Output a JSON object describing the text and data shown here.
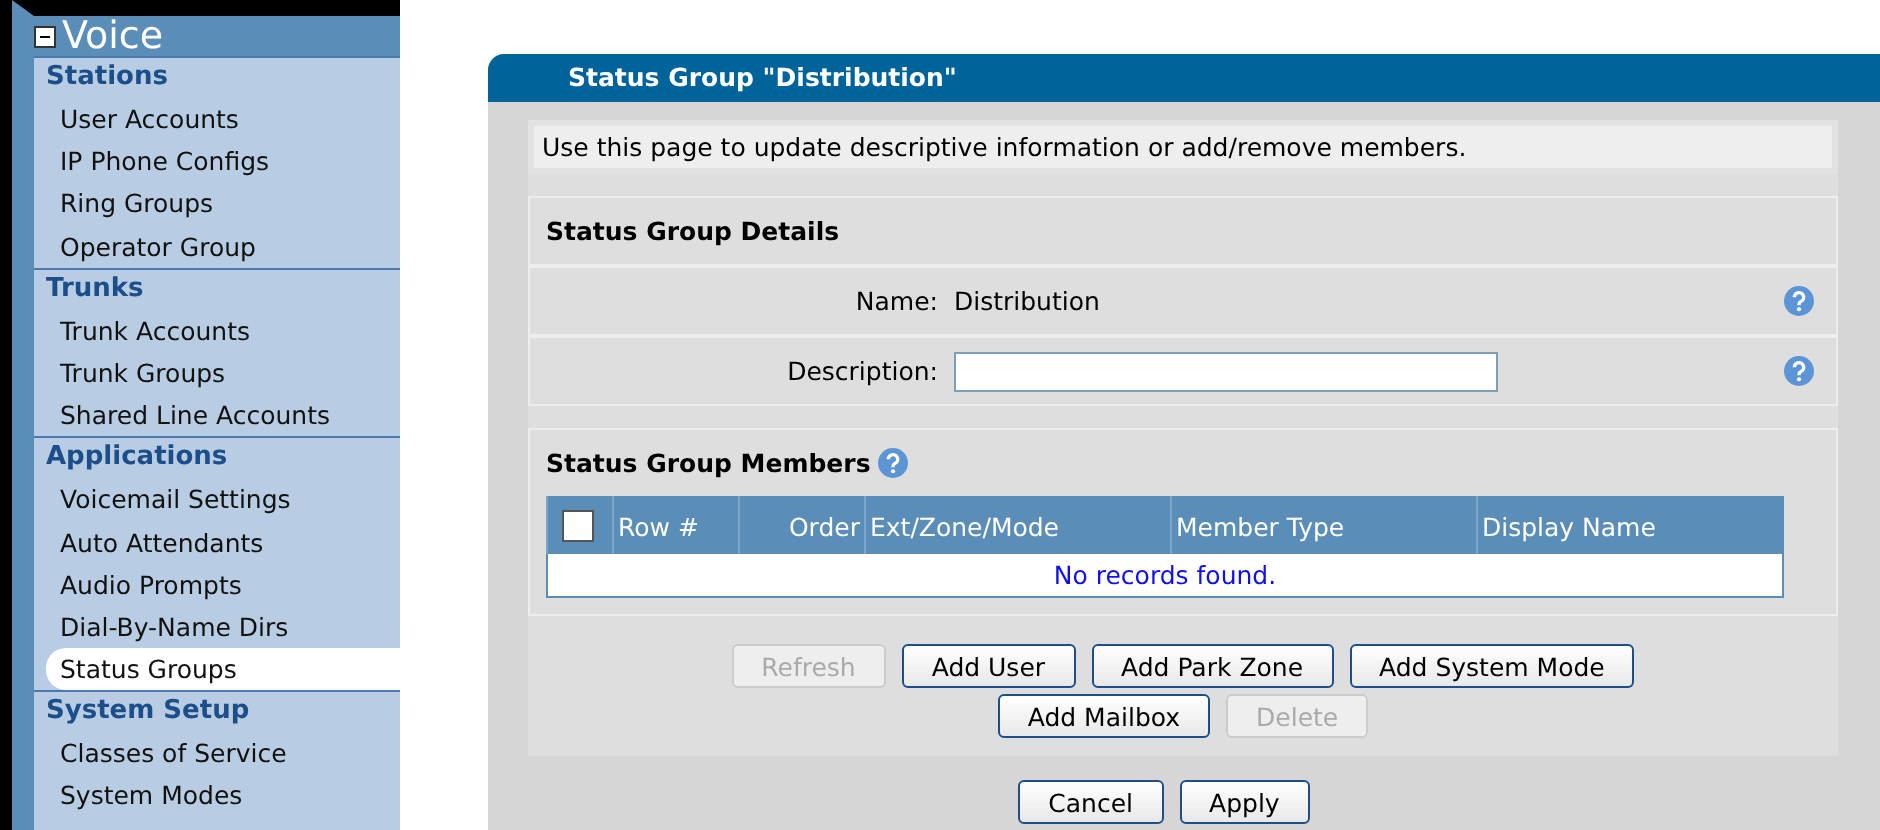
{
  "sidebar": {
    "title": "Voice",
    "expanded": true,
    "sections": [
      {
        "heading": "Stations",
        "items": [
          {
            "label": "User Accounts",
            "selected": false
          },
          {
            "label": "IP Phone Configs",
            "selected": false
          },
          {
            "label": "Ring Groups",
            "selected": false
          },
          {
            "label": "Operator Group",
            "selected": false
          }
        ]
      },
      {
        "heading": "Trunks",
        "items": [
          {
            "label": "Trunk Accounts",
            "selected": false
          },
          {
            "label": "Trunk Groups",
            "selected": false
          },
          {
            "label": "Shared Line Accounts",
            "selected": false
          }
        ]
      },
      {
        "heading": "Applications",
        "items": [
          {
            "label": "Voicemail Settings",
            "selected": false
          },
          {
            "label": "Auto Attendants",
            "selected": false
          },
          {
            "label": "Audio Prompts",
            "selected": false
          },
          {
            "label": "Dial-By-Name Dirs",
            "selected": false
          },
          {
            "label": "Status Groups",
            "selected": true
          }
        ]
      },
      {
        "heading": "System Setup",
        "items": [
          {
            "label": "Classes of Service",
            "selected": false
          },
          {
            "label": "System Modes",
            "selected": false
          }
        ]
      }
    ]
  },
  "panel": {
    "title": "Status Group \"Distribution\"",
    "intro": "Use this page to update descriptive information or add/remove members.",
    "details": {
      "heading": "Status Group Details",
      "name_label": "Name:",
      "name_value": "Distribution",
      "description_label": "Description:"
    },
    "members": {
      "heading": "Status Group Members",
      "select_all_checked": false,
      "columns": [
        "Row #",
        "Order",
        "Ext/Zone/Mode",
        "Member Type",
        "Display Name"
      ],
      "empty_message": "No records found."
    },
    "member_buttons": [
      [
        {
          "label": "Refresh",
          "disabled": true
        },
        {
          "label": "Add User",
          "disabled": false
        },
        {
          "label": "Add Park Zone",
          "disabled": false
        },
        {
          "label": "Add System Mode",
          "disabled": false
        }
      ],
      [
        {
          "label": "Add Mailbox",
          "disabled": false
        },
        {
          "label": "Delete",
          "disabled": true
        }
      ]
    ],
    "form_buttons": [
      {
        "label": "Cancel",
        "disabled": false
      },
      {
        "label": "Apply",
        "disabled": false
      }
    ]
  }
}
